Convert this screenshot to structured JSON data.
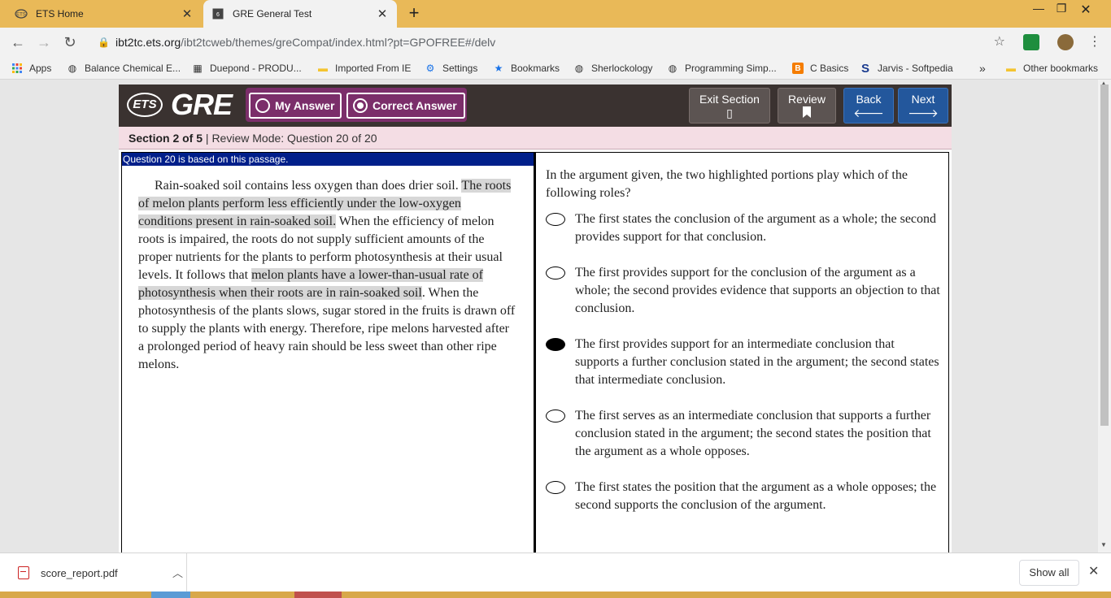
{
  "browser": {
    "tabs": [
      {
        "title": "ETS Home",
        "active": false
      },
      {
        "title": "GRE General Test",
        "active": true
      }
    ],
    "url_host": "ibt2tc.ets.org",
    "url_path": "/ibt2tcweb/themes/greCompat/index.html?pt=GPOFREE#/delv",
    "bookmarks": [
      {
        "label": "Apps",
        "icon": "apps-grid-icon"
      },
      {
        "label": "Balance Chemical E...",
        "icon": "globe-icon"
      },
      {
        "label": "Duepond - PRODU...",
        "icon": "building-icon"
      },
      {
        "label": "Imported From IE",
        "icon": "folder-icon"
      },
      {
        "label": "Settings",
        "icon": "gear-icon"
      },
      {
        "label": "Bookmarks",
        "icon": "star-icon"
      },
      {
        "label": "Sherlockology",
        "icon": "globe-icon"
      },
      {
        "label": "Programming Simp...",
        "icon": "globe-icon"
      },
      {
        "label": "C Basics",
        "icon": "blogger-icon"
      },
      {
        "label": "Jarvis - Softpedia",
        "icon": "softpedia-icon"
      }
    ],
    "overflow_label": "»",
    "other_bookmarks": "Other bookmarks"
  },
  "gre": {
    "ets_logo": "ETS",
    "gre_logo": "GRE",
    "my_answer_label": "My Answer",
    "correct_answer_label": "Correct Answer",
    "exit_label": "Exit Section",
    "review_label": "Review",
    "back_label": "Back",
    "next_label": "Next",
    "section": "Section 2 of 5",
    "mode": " | Review Mode: Question 20 of 20",
    "passage_header": "Question 20 is based on this passage.",
    "passage": {
      "p1": "Rain-soaked soil contains less oxygen than does drier soil. ",
      "h1": "The roots of melon plants perform less efficiently under the low-oxygen conditions present in rain-soaked soil.",
      "p2": " When the efficiency of melon roots is impaired, the roots do not supply sufficient amounts of the proper nutrients for the plants to perform photosynthesis at their usual levels. It follows that ",
      "h2": "melon plants have a lower-than-usual rate of photosynthesis when their roots are in rain-soaked soil",
      "p3": ". When the photosynthesis of the plants slows, sugar stored in the fruits is drawn off to supply the plants with energy. Therefore, ripe melons harvested after a prolonged period of heavy rain should be less sweet than other ripe melons."
    },
    "question": "In the argument given, the two highlighted portions play which of the following roles?",
    "choices": [
      {
        "text": "The first states the conclusion of the argument as a whole; the second provides support for that conclusion.",
        "selected": false
      },
      {
        "text": "The first provides support for the conclusion of the argument as a whole; the second provides evidence that supports an objection to that conclusion.",
        "selected": false
      },
      {
        "text": "The first provides support for an intermediate conclusion that supports a further conclusion stated in the argument; the second states that intermediate conclusion.",
        "selected": true
      },
      {
        "text": "The first serves as an intermediate conclusion that supports a further conclusion stated in the argument; the second states the position that the argument as a whole opposes.",
        "selected": false
      },
      {
        "text": "The first states the position that the argument as a whole opposes; the second supports the conclusion of the argument.",
        "selected": false
      }
    ]
  },
  "downloads": {
    "file": "score_report.pdf",
    "show_all": "Show all"
  }
}
